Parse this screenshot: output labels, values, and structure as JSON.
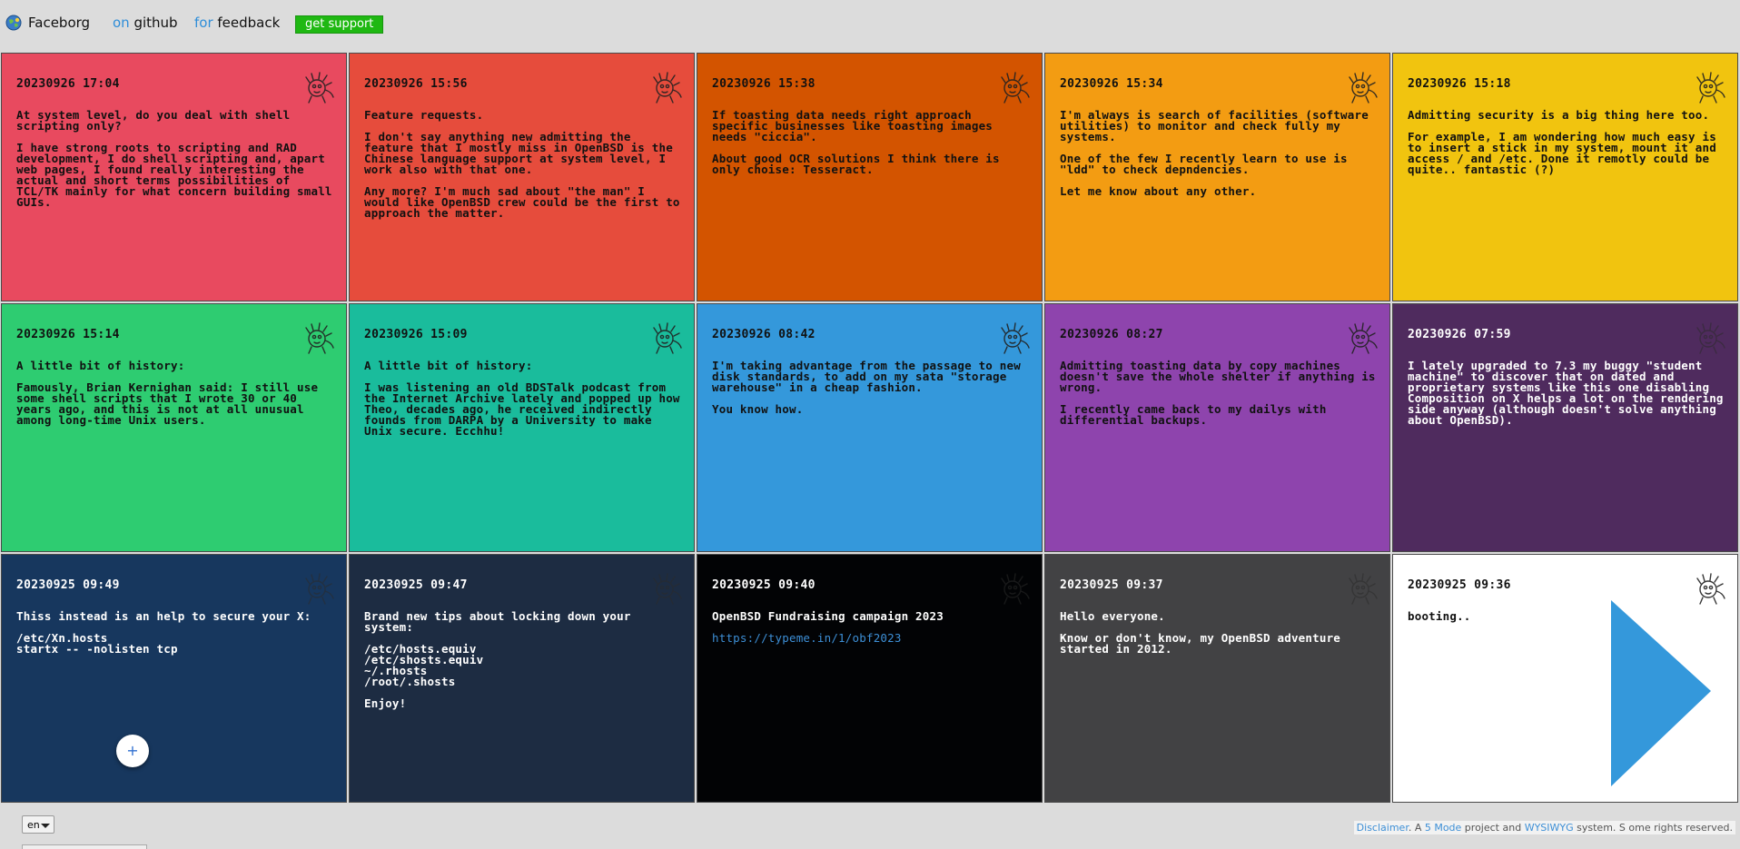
{
  "header": {
    "brand": "Faceborg",
    "github_prefix": "on",
    "github_label": "github",
    "feedback_prefix": "for",
    "feedback_label": "feedback",
    "support_label": "get support"
  },
  "cards": [
    {
      "date": "20230926 17:04",
      "bg": "#e84a5f",
      "fg": "#111111",
      "paragraphs": [
        "At system level, do you deal with shell scripting only?",
        "I have strong roots to scripting and RAD development, I do shell scripting and, apart web pages, I found really interesting the actual and short terms possibilities of TCL/TK mainly for what concern building small GUIs."
      ]
    },
    {
      "date": "20230926 15:56",
      "bg": "#e64c3c",
      "fg": "#111111",
      "paragraphs": [
        "Feature requests.",
        "I don't say anything new admitting the feature that I mostly miss in OpenBSD is the Chinese language support at system level, I work also with that one.",
        "Any more? I'm much sad about \"the man\" I would like OpenBSD crew could be the first to approach the matter."
      ]
    },
    {
      "date": "20230926 15:38",
      "bg": "#d35400",
      "fg": "#111111",
      "paragraphs": [
        "If toasting data needs right approach specific businesses like toasting images needs \"ciccia\".",
        "About good OCR solutions I think there is only choise: Tesseract."
      ]
    },
    {
      "date": "20230926 15:34",
      "bg": "#f39c12",
      "fg": "#111111",
      "paragraphs": [
        "I'm always is search of facilities (software utilities) to monitor and check fully my systems.",
        "One of the few I recently learn to use is \"ldd\" to check depndencies.",
        "Let me know about any other."
      ]
    },
    {
      "date": "20230926 15:18",
      "bg": "#f1c40f",
      "fg": "#111111",
      "paragraphs": [
        "Admitting security is a big thing here too.",
        "For example, I am wondering how much easy is to insert a stick in my system, mount it and access / and /etc. Done it remotly could be quite.. fantastic (?)"
      ]
    },
    {
      "date": "20230926 15:14",
      "bg": "#2ecc71",
      "fg": "#111111",
      "paragraphs": [
        "A little bit of history:",
        "Famously, Brian Kernighan said: I still use some shell scripts that I wrote 30 or 40 years ago, and this is not at all unusual among long-time Unix users."
      ]
    },
    {
      "date": "20230926 15:09",
      "bg": "#1abc9c",
      "fg": "#111111",
      "paragraphs": [
        "A little bit of history:",
        "I was listening an old BDSTalk podcast from the Internet Archive lately and popped up how Theo, decades ago, he received indirectly founds from DARPA by a University to make Unix secure. Ecchhu!"
      ]
    },
    {
      "date": "20230926 08:42",
      "bg": "#3498db",
      "fg": "#111111",
      "paragraphs": [
        "I'm taking advantage from the passage to new disk standards, to add on my sata \"storage warehouse\" in a cheap fashion.",
        "You know how."
      ]
    },
    {
      "date": "20230926 08:27",
      "bg": "#8e44ad",
      "fg": "#111111",
      "paragraphs": [
        "Admitting toasting data by copy machines doesn't save the whole shelter if anything is wrong.",
        "I recently came back to my dailys with differential backups."
      ]
    },
    {
      "date": "20230926 07:59",
      "bg": "#4f2b5e",
      "fg": "#ffffff",
      "paragraphs": [
        "I lately upgraded to 7.3 my buggy \"student machine\" to discover that on dated and proprietary systems like this one disabling Composition on X helps a lot on the rendering side anyway (although doesn't solve anything about OpenBSD)."
      ]
    },
    {
      "date": "20230925 09:49",
      "bg": "#17375e",
      "fg": "#ffffff",
      "paragraphs": [
        "Thiss instead is an help to secure your X:",
        "/etc/Xn.hosts\nstartx -- -nolisten tcp"
      ]
    },
    {
      "date": "20230925 09:47",
      "bg": "#1d2c42",
      "fg": "#ffffff",
      "paragraphs": [
        "Brand new tips about locking down your system:",
        "/etc/hosts.equiv\n/etc/shosts.equiv\n~/.rhosts\n/root/.shosts",
        "Enjoy!"
      ]
    },
    {
      "date": "20230925 09:40",
      "bg": "#020305",
      "fg": "#ffffff",
      "paragraphs": [
        "OpenBSD Fundraising campaign 2023"
      ],
      "link": "https://typeme.in/1/obf2023"
    },
    {
      "date": "20230925 09:37",
      "bg": "#424244",
      "fg": "#ffffff",
      "paragraphs": [
        "Hello everyone.",
        "Know or don't know, my OpenBSD adventure started in 2012."
      ]
    },
    {
      "date": "20230925 09:36",
      "bg": "#ffffff",
      "fg": "#111111",
      "paragraphs": [
        "booting.."
      ]
    }
  ],
  "add_button_label": "+",
  "language": "en",
  "footer": {
    "disclaimer": "Disclaimer",
    "text_a": ". A ",
    "mode": "5 Mode",
    "text_b": " project and ",
    "wysiwyg": "WYSIWYG",
    "text_c": " system. S ome rights reserved."
  },
  "colors": {
    "support_green": "#1fb812",
    "link_blue": "#3d8fd6",
    "play_blue": "#3498db"
  },
  "icons": {
    "logo": "globe-icon",
    "mascot": "puffy-mascot-icon",
    "play": "play-triangle-icon",
    "add": "plus-icon",
    "caret": "chevron-down-icon"
  }
}
